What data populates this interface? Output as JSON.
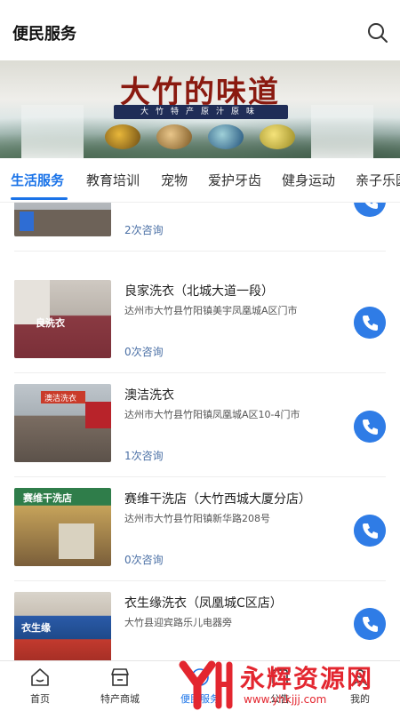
{
  "header": {
    "title": "便民服务",
    "search_icon": "search-icon"
  },
  "banner": {
    "headline": "大竹的味道",
    "subtitle": "大竹特产原汁原味"
  },
  "tabs": [
    {
      "label": "生活服务",
      "active": true
    },
    {
      "label": "教育培训",
      "active": false
    },
    {
      "label": "宠物",
      "active": false
    },
    {
      "label": "爱护牙齿",
      "active": false
    },
    {
      "label": "健身运动",
      "active": false
    },
    {
      "label": "亲子乐园",
      "active": false
    }
  ],
  "listings": [
    {
      "name": "",
      "address": "",
      "consult": "2次咨询"
    },
    {
      "name": "良家洗衣（北城大道一段）",
      "address": "达州市大竹县竹阳镇美宇凤凰城A区门市",
      "consult": "0次咨询"
    },
    {
      "name": "澳洁洗衣",
      "address": "达州市大竹县竹阳镇凤凰城A区10-4门市",
      "consult": "1次咨询"
    },
    {
      "name": "赛维干洗店（大竹西城大厦分店）",
      "address": "达州市大竹县竹阳镇新华路208号",
      "consult": "0次咨询"
    },
    {
      "name": "衣生缘洗衣（凤凰城C区店）",
      "address": "大竹县迎宾路乐儿电器旁",
      "consult": ""
    }
  ],
  "photo_signs": {
    "shop1": "良洗衣",
    "shop2": "澳洁洗衣",
    "shop3": "赛维干洗店",
    "shop4": "衣生缘"
  },
  "bottom_nav": [
    {
      "label": "首页",
      "icon": "home-icon",
      "active": false
    },
    {
      "label": "特产商城",
      "icon": "store-icon",
      "active": false
    },
    {
      "label": "便民服务",
      "icon": "service-icon",
      "active": true
    },
    {
      "label": "公告",
      "icon": "notice-icon",
      "active": false
    },
    {
      "label": "我的",
      "icon": "user-icon",
      "active": false
    }
  ],
  "watermark": {
    "text": "永辉资源网",
    "url": "www.yhkjjj.com"
  },
  "colors": {
    "accent": "#1a73e8",
    "call_button": "#2f7ce6",
    "consult_text": "#4a6fa5",
    "watermark": "#e3262f"
  }
}
